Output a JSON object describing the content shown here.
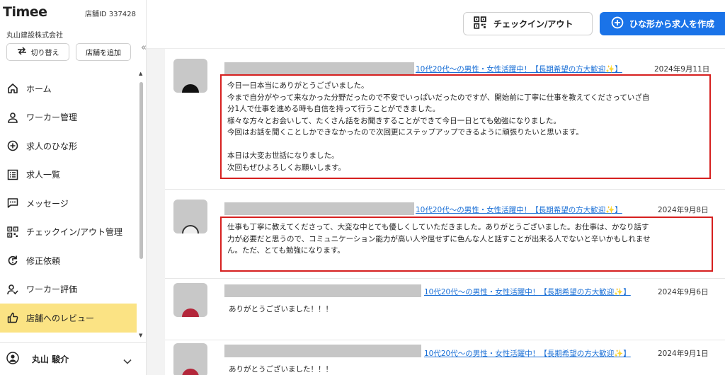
{
  "sidebar": {
    "logo": "Timee",
    "store_id": "店舗ID 337428",
    "company": "丸山建設株式会社",
    "switch_label": "切り替え",
    "add_store_label": "店舗を追加",
    "collapse_glyph": "«",
    "items": [
      {
        "label": "ホーム",
        "icon": "home-icon"
      },
      {
        "label": "ワーカー管理",
        "icon": "person-icon"
      },
      {
        "label": "求人のひな形",
        "icon": "plus-circle-icon"
      },
      {
        "label": "求人一覧",
        "icon": "list-icon"
      },
      {
        "label": "メッセージ",
        "icon": "message-icon"
      },
      {
        "label": "チェックイン/アウト管理",
        "icon": "qr-icon"
      },
      {
        "label": "修正依頼",
        "icon": "refresh-icon"
      },
      {
        "label": "ワーカー評価",
        "icon": "person-check-icon"
      },
      {
        "label": "店舗へのレビュー",
        "icon": "thumbs-up-icon",
        "active": true
      }
    ],
    "user_name": "丸山 駿介"
  },
  "header": {
    "checkin_label": "チェックイン/アウト",
    "create_label": "ひな形から求人を作成"
  },
  "colors": {
    "accent_blue": "#1a73e8",
    "active_nav": "#fbe384",
    "highlight_red": "#d6201f",
    "link": "#1a6fd6"
  },
  "reviews": [
    {
      "job": "10代20代〜の男性・女性活躍中！【長期希望の方大歓迎✨】",
      "date": "2024年9月11日",
      "lines": [
        "今日一日本当にありがとうございました。",
        "今まで自分がやって来なかった分野だったので不安でいっぱいだったのですが、開始前に丁寧に仕事を教えてくださっていざ自",
        "分1人で仕事を進める時も自信を持って行うことができました。",
        "様々な方々とお会いして、たくさん話をお聞きすることができて今日一日とても勉強になりました。",
        "今回はお話を聞くことしかできなかったので次回更にステップアップできるように頑張りたいと思います。",
        "",
        "本日は大変お世話になりました。",
        "次回もぜひよろしくお願いします。"
      ],
      "highlighted": true
    },
    {
      "job": "10代20代〜の男性・女性活躍中！【長期希望の方大歓迎✨】",
      "date": "2024年9月8日",
      "lines": [
        "仕事も丁寧に教えてくださって、大変な中とても優しくしていただきました。ありがとうございました。お仕事は、かなり話す",
        "力が必要だと思うので、コミュニケーション能力が高い人や屈せずに色んな人と話すことが出来る人でないと辛いかもしれませ",
        "ん。ただ、とても勉強になります。"
      ],
      "highlighted": true
    },
    {
      "job": "10代20代〜の男性・女性活躍中！【長期希望の方大歓迎✨】",
      "date": "2024年9月6日",
      "lines": [
        "ありがとうございました！！！"
      ],
      "highlighted": false
    },
    {
      "job": "10代20代〜の男性・女性活躍中！【長期希望の方大歓迎✨】",
      "date": "2024年9月1日",
      "lines": [
        "ありがとうございました！！！"
      ],
      "highlighted": false
    }
  ]
}
